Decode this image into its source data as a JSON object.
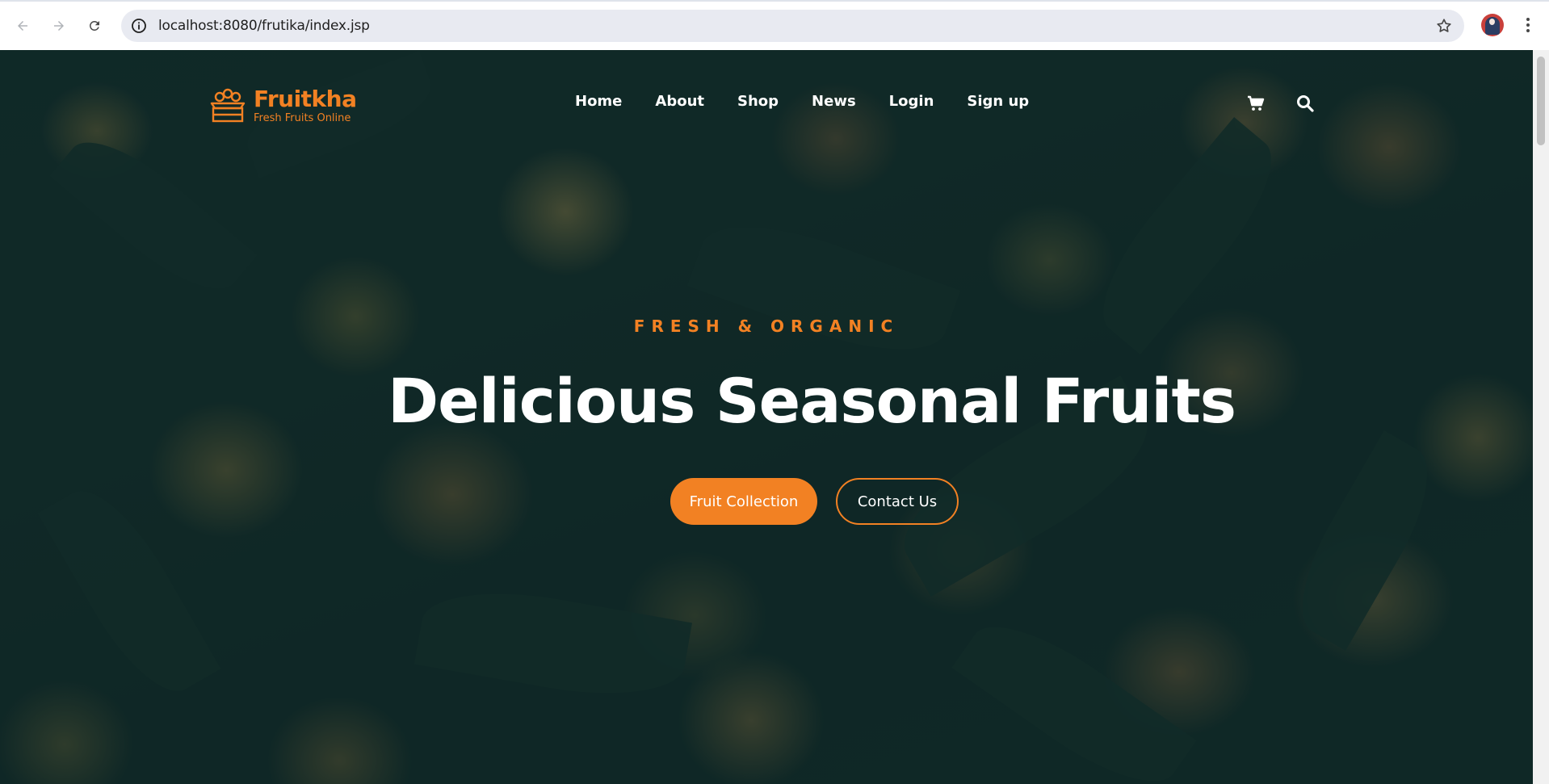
{
  "browser": {
    "url": "localhost:8080/frutika/index.jsp"
  },
  "site": {
    "brand": "Fruitkha",
    "tagline": "Fresh Fruits Online",
    "accent_color": "#f28123",
    "nav": [
      {
        "label": "Home"
      },
      {
        "label": "About"
      },
      {
        "label": "Shop"
      },
      {
        "label": "News"
      },
      {
        "label": "Login"
      },
      {
        "label": "Sign up"
      }
    ],
    "header_icons": [
      "shopping-cart-icon",
      "search-icon"
    ]
  },
  "hero": {
    "subtitle": "FRESH & ORGANIC",
    "title": "Delicious Seasonal Fruits",
    "primary_button": "Fruit Collection",
    "secondary_button": "Contact Us"
  }
}
